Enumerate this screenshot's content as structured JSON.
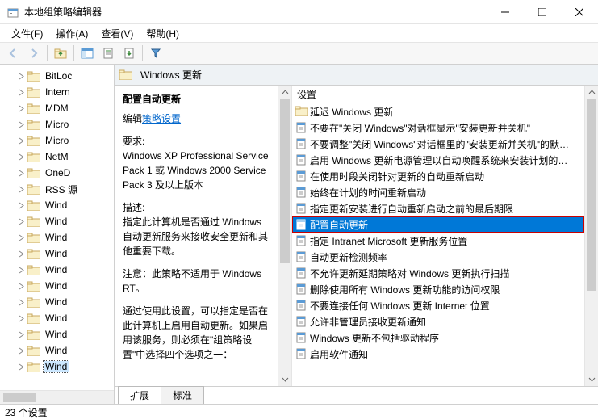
{
  "window": {
    "title": "本地组策略编辑器"
  },
  "menu": {
    "file": "文件(F)",
    "action": "操作(A)",
    "view": "查看(V)",
    "help": "帮助(H)"
  },
  "tree": {
    "items": [
      {
        "label": "BitLoc"
      },
      {
        "label": "Intern"
      },
      {
        "label": "MDM"
      },
      {
        "label": "Micro"
      },
      {
        "label": "Micro"
      },
      {
        "label": "NetM"
      },
      {
        "label": "OneD"
      },
      {
        "label": "RSS 源"
      },
      {
        "label": "Wind"
      },
      {
        "label": "Wind"
      },
      {
        "label": "Wind"
      },
      {
        "label": "Wind"
      },
      {
        "label": "Wind"
      },
      {
        "label": "Wind"
      },
      {
        "label": "Wind"
      },
      {
        "label": "Wind"
      },
      {
        "label": "Wind"
      },
      {
        "label": "Wind"
      },
      {
        "label": "Wind",
        "selected": true
      }
    ]
  },
  "header": {
    "title": "Windows 更新"
  },
  "desc": {
    "heading": "配置自动更新",
    "edit_link_prefix": "编辑",
    "edit_link": "策略设置",
    "req_label": "要求:",
    "req_text": "Windows XP Professional Service Pack 1 或 Windows 2000 Service Pack 3 及以上版本",
    "desc_label": "描述:",
    "desc_text": "指定此计算机是否通过 Windows 自动更新服务来接收安全更新和其他重要下载。",
    "note_text": "注意：此策略不适用于 Windows RT。",
    "para_text": "通过使用此设置，可以指定是否在此计算机上启用自动更新。如果启用该服务，则必须在\"组策略设置\"中选择四个选项之一："
  },
  "list": {
    "column": "设置",
    "items": [
      {
        "type": "folder",
        "label": "延迟 Windows 更新"
      },
      {
        "type": "setting",
        "label": "不要在\"关闭 Windows\"对话框显示\"安装更新并关机\""
      },
      {
        "type": "setting",
        "label": "不要调整\"关闭 Windows\"对话框里的\"安装更新并关机\"的默…"
      },
      {
        "type": "setting",
        "label": "启用 Windows 更新电源管理以自动唤醒系统来安装计划的…"
      },
      {
        "type": "setting",
        "label": "在使用时段关闭针对更新的自动重新启动"
      },
      {
        "type": "setting",
        "label": "始终在计划的时间重新启动"
      },
      {
        "type": "setting",
        "label": "指定更新安装进行自动重新启动之前的最后期限"
      },
      {
        "type": "setting",
        "label": "配置自动更新",
        "selected": true
      },
      {
        "type": "setting",
        "label": "指定 Intranet Microsoft 更新服务位置"
      },
      {
        "type": "setting",
        "label": "自动更新检测频率"
      },
      {
        "type": "setting",
        "label": "不允许更新延期策略对 Windows 更新执行扫描"
      },
      {
        "type": "setting",
        "label": "删除使用所有 Windows 更新功能的访问权限"
      },
      {
        "type": "setting",
        "label": "不要连接任何 Windows 更新 Internet 位置"
      },
      {
        "type": "setting",
        "label": "允许非管理员接收更新通知"
      },
      {
        "type": "setting",
        "label": "Windows 更新不包括驱动程序"
      },
      {
        "type": "setting",
        "label": "启用软件通知"
      }
    ]
  },
  "tabs": {
    "extended": "扩展",
    "standard": "标准"
  },
  "status": {
    "text": "23 个设置"
  }
}
